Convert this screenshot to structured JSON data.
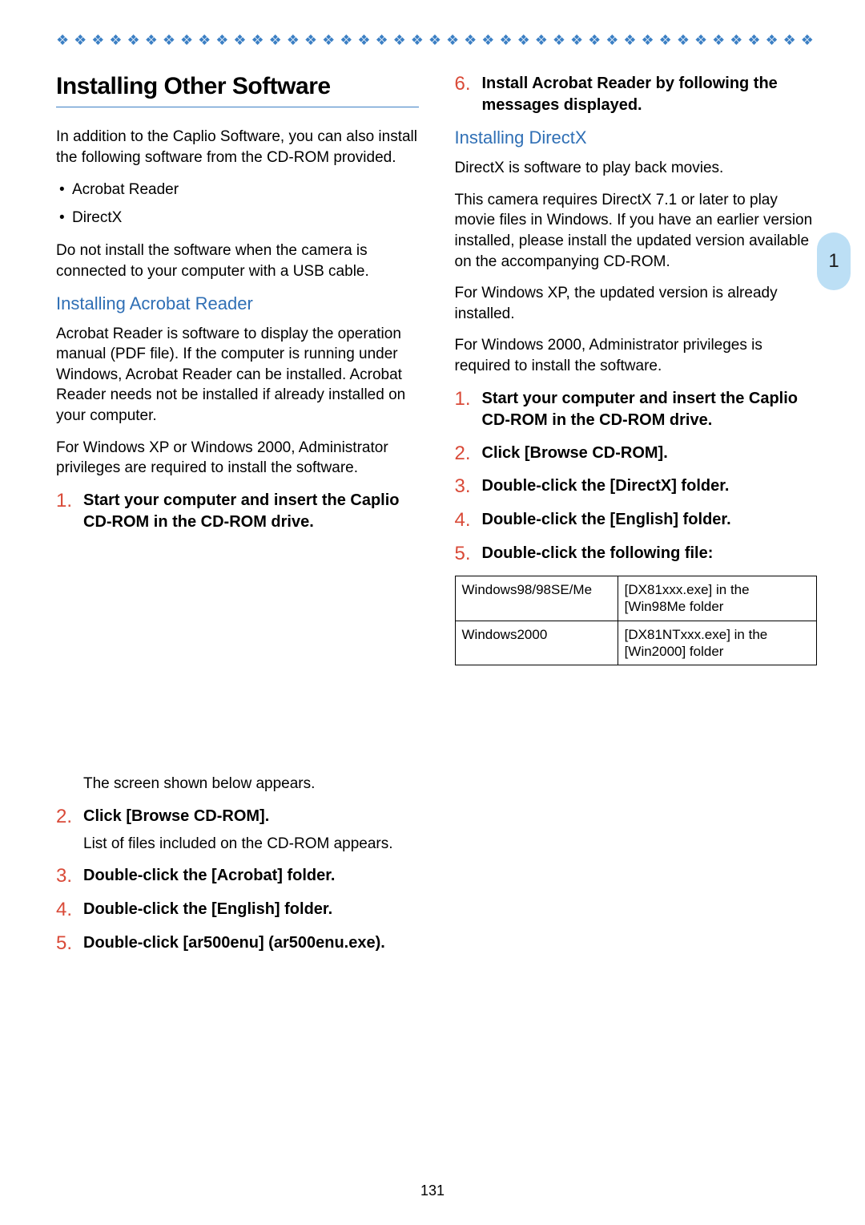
{
  "decor": "❖ ❖ ❖ ❖ ❖ ❖ ❖ ❖ ❖ ❖ ❖ ❖ ❖ ❖ ❖ ❖ ❖ ❖ ❖ ❖ ❖ ❖ ❖ ❖ ❖ ❖ ❖ ❖ ❖ ❖ ❖ ❖ ❖ ❖ ❖ ❖ ❖ ❖ ❖ ❖ ❖ ❖ ❖ ❖ ❖ ❖ ❖ ❖ ❖ ❖ ❖",
  "sideTab": "1",
  "pageNumber": "131",
  "left": {
    "title": "Installing Other Software",
    "intro1": "In addition to the Caplio Software, you can also install the following software from the CD-ROM provided.",
    "bullets": [
      "Acrobat Reader",
      "DirectX"
    ],
    "intro2": "Do not install the software when the camera is connected to your computer with a USB cable.",
    "h2a": "Installing Acrobat Reader",
    "p_a1": "Acrobat Reader is software to display the operation manual (PDF file). If the computer is running under Windows, Acrobat Reader can be installed. Acrobat Reader needs not be installed if already installed on your computer.",
    "p_a2": "For Windows XP or Windows 2000, Administrator privileges are required to install the software.",
    "steps_a": [
      {
        "n": "1.",
        "t": "Start your computer and insert the Caplio CD-ROM in the CD-ROM drive.",
        "sub": "The screen shown below appears."
      },
      {
        "n": "2.",
        "t": "Click [Browse CD-ROM].",
        "sub": "List of files included on the CD-ROM appears."
      },
      {
        "n": "3.",
        "t": "Double-click the [Acrobat] folder."
      },
      {
        "n": "4.",
        "t": "Double-click the [English] folder."
      },
      {
        "n": "5.",
        "t": "Double-click [ar500enu] (ar500enu.exe)."
      }
    ]
  },
  "right": {
    "step6": {
      "n": "6.",
      "t": "Install Acrobat Reader by following the messages displayed."
    },
    "h2b": "Installing DirectX",
    "p_b1": "DirectX is software to play back movies.",
    "p_b2": "This camera requires DirectX 7.1 or later to play movie files in Windows. If you have an earlier version installed, please install the updated version available on the accompanying CD-ROM.",
    "p_b3": "For Windows XP, the updated version is already installed.",
    "p_b4": "For Windows 2000, Administrator privileges is required to install the software.",
    "steps_b": [
      {
        "n": "1.",
        "t": "Start your computer and insert the Caplio CD-ROM in the CD-ROM drive."
      },
      {
        "n": "2.",
        "t": "Click [Browse CD-ROM]."
      },
      {
        "n": "3.",
        "t": "Double-click the [DirectX] folder."
      },
      {
        "n": "4.",
        "t": "Double-click the [English] folder."
      },
      {
        "n": "5.",
        "t": "Double-click the following file:"
      }
    ],
    "table": [
      {
        "os": "Windows98/98SE/Me",
        "file": "[DX81xxx.exe] in the [Win98Me folder"
      },
      {
        "os": "Windows2000",
        "file": "[DX81NTxxx.exe] in the [Win2000] folder"
      }
    ]
  }
}
